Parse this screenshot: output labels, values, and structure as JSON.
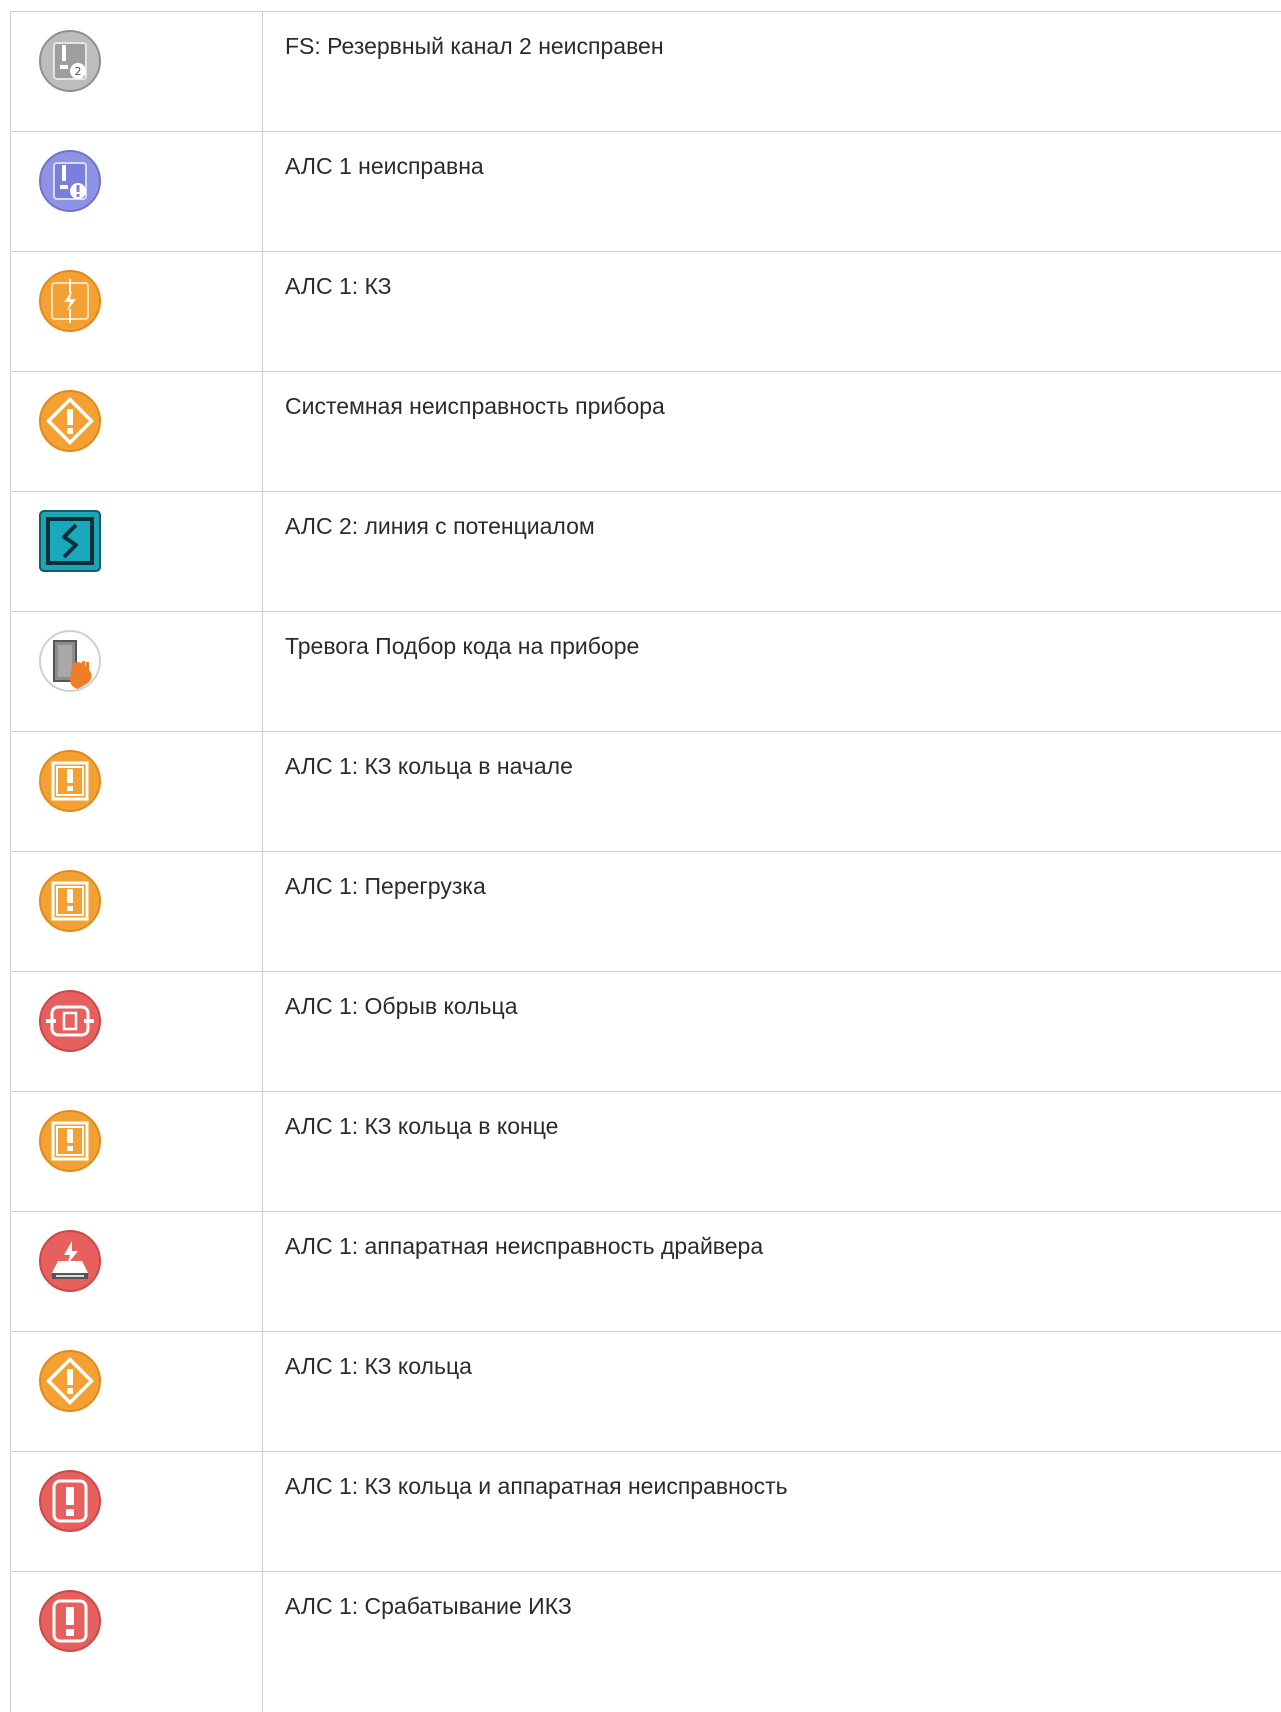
{
  "rows": [
    {
      "icon": "backup-channel-fault-icon",
      "color": "#9e9e9e",
      "text": "FS: Резервный канал 2 неисправен"
    },
    {
      "icon": "line-fault-icon",
      "color": "#7b7fdb",
      "text": "АЛС 1 неисправна"
    },
    {
      "icon": "short-circuit-icon",
      "color": "#f5a033",
      "text": "АЛС 1: КЗ"
    },
    {
      "icon": "system-fault-icon",
      "color": "#f5a033",
      "text": "Системная неисправность прибора"
    },
    {
      "icon": "line-potential-icon",
      "color": "#1fa3b5",
      "text": "АЛС 2: линия с потенциалом"
    },
    {
      "icon": "code-guessing-alarm-icon",
      "color": "#f07d2a",
      "text": "Тревога Подбор кода на приборе"
    },
    {
      "icon": "ring-short-start-icon",
      "color": "#f5a033",
      "text": "АЛС 1: КЗ кольца в начале"
    },
    {
      "icon": "overload-icon",
      "color": "#f5a033",
      "text": "АЛС 1: Перегрузка"
    },
    {
      "icon": "ring-break-icon",
      "color": "#e8605e",
      "text": "АЛС 1: Обрыв кольца"
    },
    {
      "icon": "ring-short-end-icon",
      "color": "#f5a033",
      "text": "АЛС 1: КЗ кольца в конце"
    },
    {
      "icon": "driver-hardware-fault-icon",
      "color": "#e8605e",
      "text": "АЛС 1: аппаратная неисправность драйвера"
    },
    {
      "icon": "ring-short-icon",
      "color": "#f5a033",
      "text": "АЛС 1: КЗ кольца"
    },
    {
      "icon": "ring-short-hardware-fault-icon",
      "color": "#e8605e",
      "text": "АЛС 1: КЗ кольца и аппаратная неисправность"
    },
    {
      "icon": "ikz-trigger-icon",
      "color": "#e8605e",
      "text": "АЛС 1: Срабатывание ИКЗ"
    }
  ]
}
